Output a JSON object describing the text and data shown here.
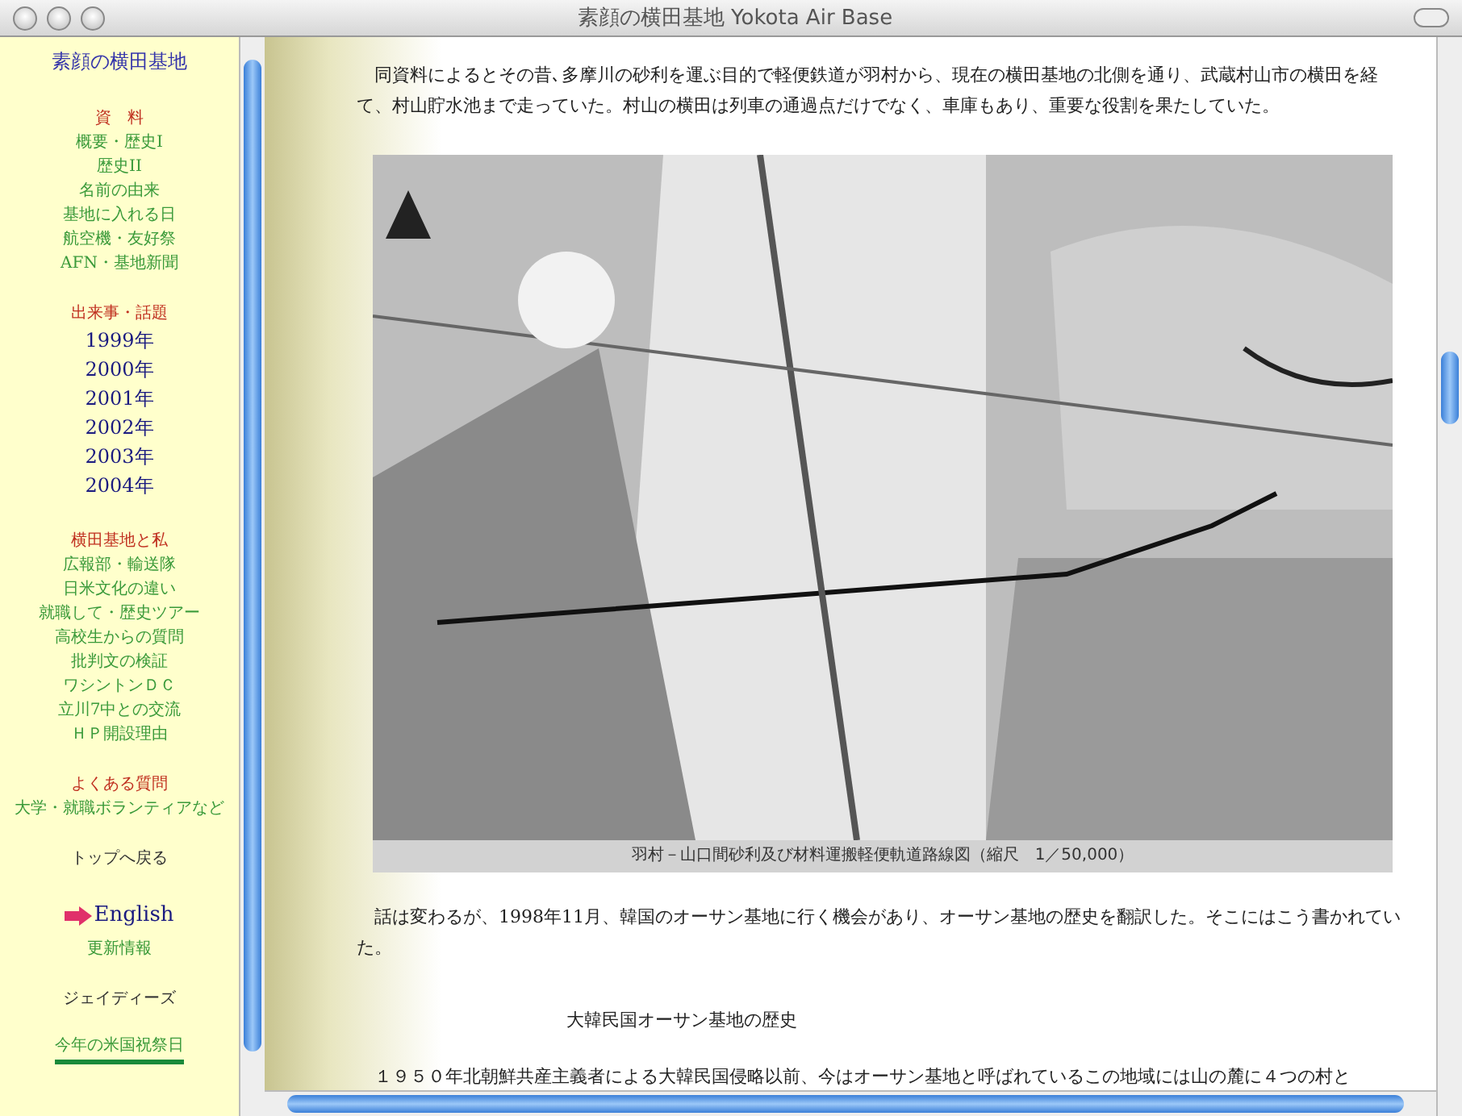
{
  "window": {
    "title": "素顔の横田基地 Yokota Air Base"
  },
  "sidebar": {
    "title": "素顔の横田基地",
    "items": [
      {
        "kind": "heading",
        "label": "資　料"
      },
      {
        "kind": "link",
        "label": "概要・歴史I"
      },
      {
        "kind": "link",
        "label": "歴史II"
      },
      {
        "kind": "link",
        "label": "名前の由来"
      },
      {
        "kind": "link",
        "label": "基地に入れる日"
      },
      {
        "kind": "link",
        "label": "航空機・友好祭"
      },
      {
        "kind": "link",
        "label": "AFN・基地新聞"
      },
      {
        "kind": "heading",
        "label": "出来事・話題"
      },
      {
        "kind": "year",
        "label": "1999年"
      },
      {
        "kind": "year",
        "label": "2000年"
      },
      {
        "kind": "year",
        "label": "2001年"
      },
      {
        "kind": "year",
        "label": "2002年"
      },
      {
        "kind": "year",
        "label": "2003年"
      },
      {
        "kind": "year",
        "label": "2004年"
      },
      {
        "kind": "heading",
        "label": "横田基地と私"
      },
      {
        "kind": "link",
        "label": "広報部・輸送隊"
      },
      {
        "kind": "link",
        "label": "日米文化の違い"
      },
      {
        "kind": "link",
        "label": "就職して・歴史ツアー"
      },
      {
        "kind": "link",
        "label": "高校生からの質問"
      },
      {
        "kind": "link",
        "label": "批判文の検証"
      },
      {
        "kind": "link",
        "label": "ワシントンＤＣ"
      },
      {
        "kind": "link",
        "label": "立川7中との交流"
      },
      {
        "kind": "link",
        "label": "ＨＰ開設理由"
      },
      {
        "kind": "heading",
        "label": "よくある質問"
      },
      {
        "kind": "link",
        "label": "大学・就職ボランティアなど"
      },
      {
        "kind": "dark",
        "label": "トップへ戻る"
      },
      {
        "kind": "english",
        "label": "English"
      },
      {
        "kind": "link",
        "label": "更新情報"
      },
      {
        "kind": "dark",
        "label": "ジェイディーズ"
      },
      {
        "kind": "underlined",
        "label": "今年の米国祝祭日"
      }
    ]
  },
  "content": [
    {
      "kind": "paragraph",
      "text": "同資料によるとその昔､多摩川の砂利を運ぶ目的で軽便鉄道が羽村から、現在の横田基地の北側を通り、武蔵村山市の横田を経て、村山貯水池まで走っていた。村山の横田は列車の通過点だけでなく、車庫もあり、重要な役割を果たしていた。"
    },
    {
      "kind": "map",
      "caption": "羽村－山口間砂利及び材料運搬軽便軌道路線図（縮尺　1／50,000）"
    },
    {
      "kind": "paragraph",
      "text": "話は変わるが、1998年11月、韓国のオーサン基地に行く機会があり、オーサン基地の歴史を翻訳した。そこにはこう書かれていた。"
    },
    {
      "kind": "heading",
      "text": "大韓民国オーサン基地の歴史"
    },
    {
      "kind": "paragraph",
      "text": "１９５０年北朝鮮共産主義者による大韓民国侵略以前、今はオーサン基地と呼ばれているこの地域には山の麓に４つの村と"
    }
  ]
}
